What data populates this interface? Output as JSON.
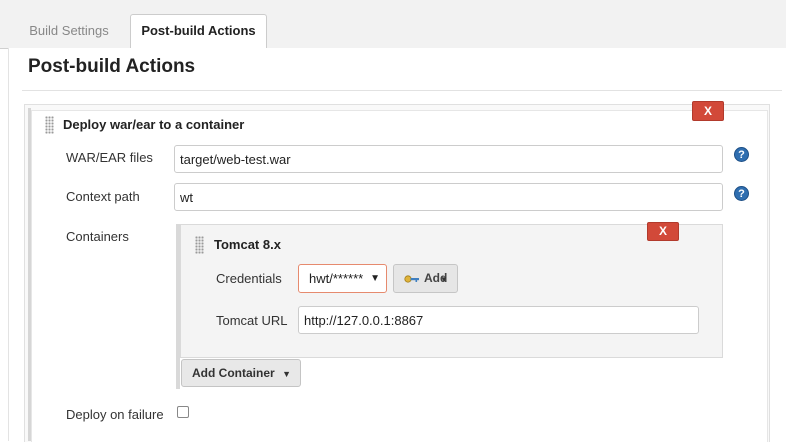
{
  "tabs": [
    {
      "label": "Build Settings",
      "active": false
    },
    {
      "label": "Post-build Actions",
      "active": true
    }
  ],
  "section": {
    "title": "Post-build Actions"
  },
  "deploy_step": {
    "title": "Deploy war/ear to a container",
    "delete_label": "X",
    "war_ear_label": "WAR/EAR files",
    "war_ear_value": "target/web-test.war",
    "context_path_label": "Context path",
    "context_path_value": "wt",
    "containers_label": "Containers",
    "help_glyph": "?",
    "deploy_on_failure_label": "Deploy on failure",
    "deploy_on_failure_checked": false
  },
  "container": {
    "title": "Tomcat 8.x",
    "delete_label": "X",
    "credentials_label": "Credentials",
    "credentials_value": "hwt/******",
    "add_label": "Add",
    "tomcat_url_label": "Tomcat URL",
    "tomcat_url_value": "http://127.0.0.1:8867"
  },
  "add_container_label": "Add Container",
  "icons": {
    "help": "help-icon",
    "key": "key-icon",
    "grip": "drag-handle-icon",
    "caret": "caret-down-icon"
  },
  "colors": {
    "delete_button": "#d24939",
    "help_icon": "#2f6eb0",
    "credentials_border": "#e68a6e"
  }
}
